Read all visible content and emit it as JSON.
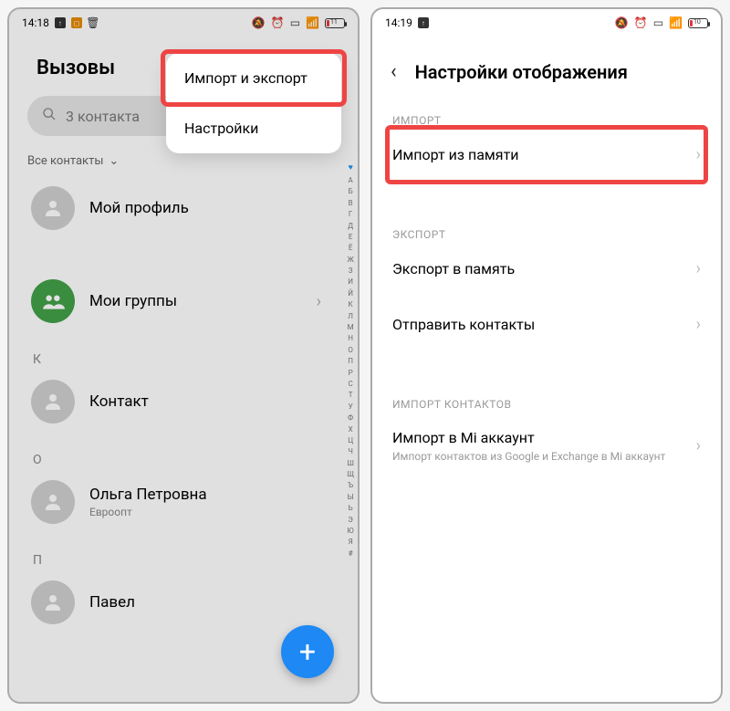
{
  "left": {
    "status": {
      "time": "14:18",
      "battery": "11"
    },
    "title": "Вызовы",
    "search_placeholder": "3 контакта",
    "filter_label": "Все контакты",
    "popover": {
      "import_export": "Импорт и экспорт",
      "settings": "Настройки"
    },
    "contacts": {
      "my_profile": "Мой профиль",
      "my_groups": "Мои группы",
      "k_header": "К",
      "contact_k": "Контакт",
      "o_header": "О",
      "contact_o_name": "Ольга Петровна",
      "contact_o_sub": "Евроопт",
      "p_header": "П",
      "contact_p": "Павел"
    },
    "alphabet": [
      "А",
      "Б",
      "В",
      "Г",
      "Д",
      "Е",
      "Ё",
      "Ж",
      "З",
      "И",
      "Й",
      "К",
      "Л",
      "М",
      "Н",
      "О",
      "П",
      "Р",
      "С",
      "Т",
      "У",
      "Ф",
      "Х",
      "Ц",
      "Ч",
      "Ш",
      "Щ",
      "Ъ",
      "Ы",
      "Ь",
      "Э",
      "Ю",
      "Я",
      "#"
    ]
  },
  "right": {
    "status": {
      "time": "14:19",
      "battery": "10"
    },
    "title": "Настройки отображения",
    "sections": {
      "import_label": "ИМПОРТ",
      "import_mem": "Импорт из памяти",
      "export_label": "ЭКСПОРТ",
      "export_mem": "Экспорт в память",
      "send_contacts": "Отправить контакты",
      "import_contacts_label": "ИМПОРТ КОНТАКТОВ",
      "mi_title": "Импорт в Mi аккаунт",
      "mi_sub": "Импорт контактов из Google и Exchange в Mi аккаунт"
    }
  }
}
